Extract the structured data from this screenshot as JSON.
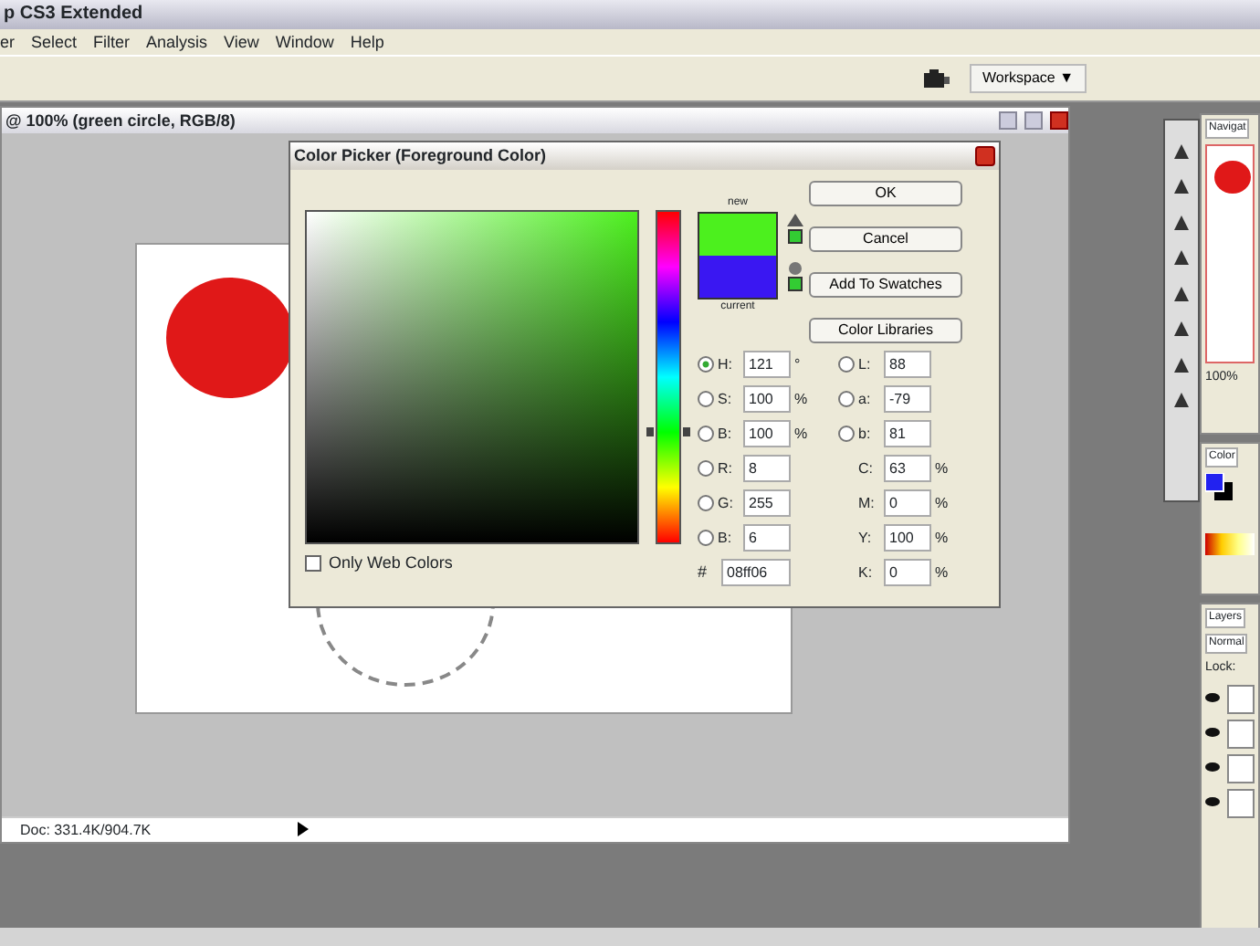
{
  "app_title": "p CS3 Extended",
  "menu": [
    "er",
    "Select",
    "Filter",
    "Analysis",
    "View",
    "Window",
    "Help"
  ],
  "options_bar": {
    "workspace_button": "Workspace ▼"
  },
  "document": {
    "title": "@ 100% (green circle, RGB/8)",
    "status": "Doc: 331.4K/904.7K"
  },
  "dialog": {
    "title": "Color Picker (Foreground Color)",
    "new_label": "new",
    "current_label": "current",
    "hue_slider": {
      "level": 0.34
    },
    "buttons": [
      "OK",
      "Cancel",
      "Add To Swatches",
      "Color Libraries"
    ],
    "fields_left": [
      {
        "kind": "radio",
        "label": "H:",
        "value": "121",
        "unit": "°",
        "selected": true
      },
      {
        "kind": "radio",
        "label": "S:",
        "value": "100",
        "unit": "%",
        "selected": false
      },
      {
        "kind": "radio",
        "label": "B:",
        "value": "100",
        "unit": "%",
        "selected": false
      },
      {
        "kind": "radio",
        "label": "R:",
        "value": "8",
        "selected": false
      },
      {
        "kind": "radio",
        "label": "G:",
        "value": "255",
        "selected": false
      },
      {
        "kind": "radio",
        "label": "B:",
        "value": "6",
        "selected": false
      }
    ],
    "fields_right": [
      {
        "kind": "radio",
        "label": "L:",
        "value": "88",
        "selected": false
      },
      {
        "kind": "radio",
        "label": "a:",
        "value": "-79",
        "selected": false
      },
      {
        "kind": "radio",
        "label": "b:",
        "value": "81",
        "selected": false
      },
      {
        "kind": "plain",
        "label": "C:",
        "value": "63",
        "unit": "%"
      },
      {
        "kind": "plain",
        "label": "M:",
        "value": "0",
        "unit": "%"
      },
      {
        "kind": "plain",
        "label": "Y:",
        "value": "100",
        "unit": "%"
      },
      {
        "kind": "plain",
        "label": "K:",
        "value": "0",
        "unit": "%"
      }
    ],
    "hex_label": "#",
    "hex": "08ff06",
    "only_web_colors": {
      "label": "Only Web Colors",
      "checked": false
    }
  },
  "panels": {
    "navigator_tab": "Navigat",
    "zoom": "100%",
    "color_tab": "Color",
    "layers_tab": "Layers",
    "blend_mode": "Normal",
    "lock_label": "Lock:"
  }
}
